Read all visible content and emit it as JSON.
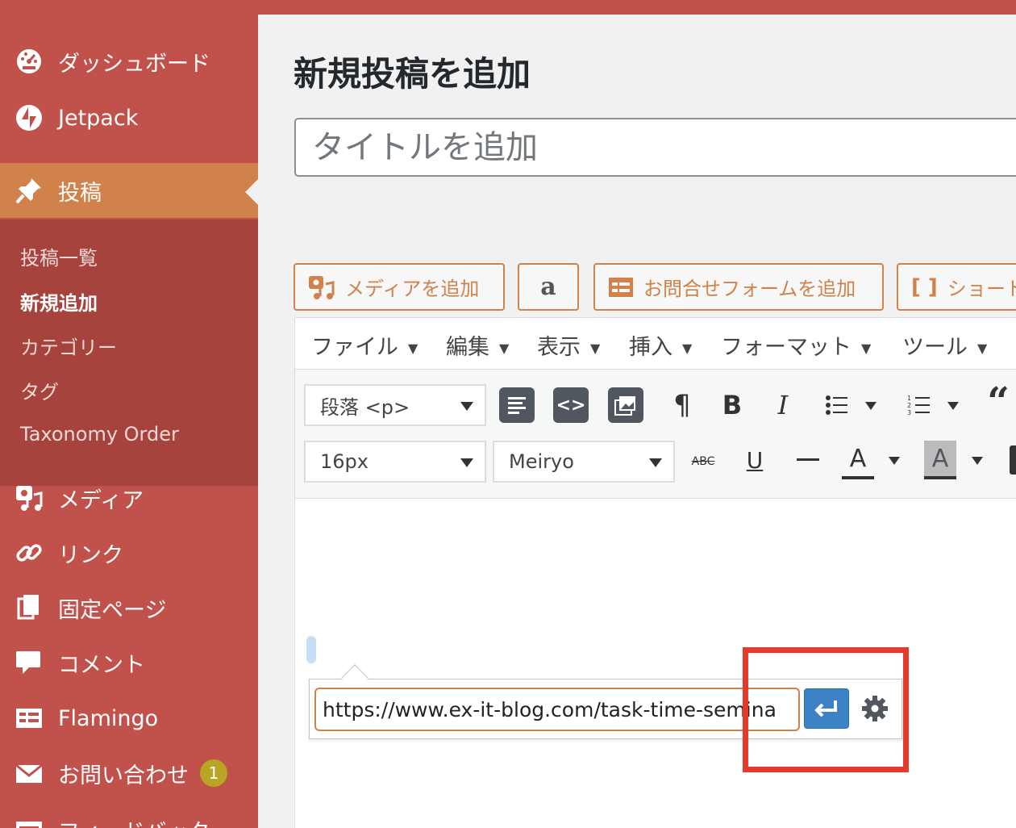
{
  "sidebar": {
    "items": [
      {
        "label": "ダッシュボード",
        "icon": "dashboard-icon"
      },
      {
        "label": "Jetpack",
        "icon": "jetpack-icon"
      },
      {
        "label": "投稿",
        "icon": "pin-icon",
        "current": true
      },
      {
        "label": "メディア",
        "icon": "media-icon"
      },
      {
        "label": "リンク",
        "icon": "link-icon"
      },
      {
        "label": "固定ページ",
        "icon": "pages-icon"
      },
      {
        "label": "コメント",
        "icon": "comment-icon"
      },
      {
        "label": "Flamingo",
        "icon": "flamingo-icon"
      },
      {
        "label": "お問い合わせ",
        "icon": "mail-icon",
        "badge": "1"
      },
      {
        "label": "フィードバック",
        "icon": "feedback-icon"
      }
    ],
    "submenu": [
      "投稿一覧",
      "新規追加",
      "カテゴリー",
      "タグ",
      "Taxonomy Order"
    ],
    "submenu_current": "新規追加"
  },
  "main": {
    "page_title": "新規投稿を追加",
    "title_placeholder": "タイトルを追加",
    "media_buttons": [
      "メディアを追加",
      "お問合せフォームを追加",
      "ショート"
    ],
    "menubar": [
      "ファイル",
      "編集",
      "表示",
      "挿入",
      "フォーマット",
      "ツール"
    ],
    "format_select": "段落 <p>",
    "font_size_select": "16px",
    "font_family_select": "Meiryo",
    "link_popup": {
      "url": "https://www.ex-it-blog.com/task-time-semina"
    }
  },
  "colors": {
    "sidebar": "#c1524b",
    "sidebar_current": "#d1824a",
    "submenu": "#a6433d",
    "accent": "#d1824a",
    "apply_button": "#3c83c5",
    "highlight": "#e5392b"
  }
}
